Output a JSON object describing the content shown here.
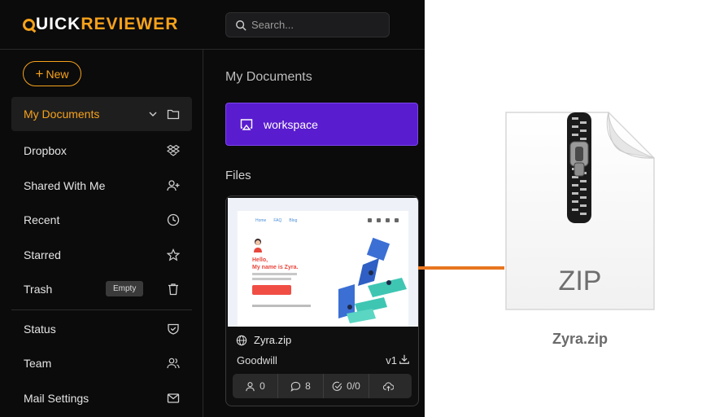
{
  "brand": {
    "logo_prefix": "Q",
    "logo_white": "UICK",
    "logo_orange": "REVIEWER"
  },
  "search": {
    "placeholder": "Search..."
  },
  "sidebar": {
    "new_label": "New",
    "items": [
      {
        "label": "My Documents",
        "icon": "folder-icon"
      },
      {
        "label": "Dropbox",
        "icon": "dropbox-icon"
      },
      {
        "label": "Shared With Me",
        "icon": "user-add-icon"
      },
      {
        "label": "Recent",
        "icon": "clock-icon"
      },
      {
        "label": "Starred",
        "icon": "star-icon"
      },
      {
        "label": "Trash",
        "icon": "trash-icon",
        "badge": "Empty"
      },
      {
        "label": "Status",
        "icon": "shield-check-icon"
      },
      {
        "label": "Team",
        "icon": "team-icon"
      },
      {
        "label": "Mail Settings",
        "icon": "mail-icon"
      }
    ]
  },
  "main": {
    "title": "My Documents",
    "workspace_label": "workspace",
    "files_title": "Files",
    "file": {
      "name": "Zyra.zip",
      "owner": "Goodwill",
      "version": "v1",
      "thumb_hello": "Hello,",
      "thumb_name": "My name is Zyra.",
      "thumb_nav": [
        "Home",
        "FAQ",
        "Blog"
      ],
      "stats": {
        "users": "0",
        "comments": "8",
        "tasks": "0/0"
      }
    }
  },
  "preview": {
    "zip_label": "ZIP",
    "caption": "Zyra.zip"
  },
  "colors": {
    "accent": "#f7a21b",
    "workspace": "#5a1ccf",
    "connector": "#e8761f",
    "background": "#0b0b0b"
  }
}
